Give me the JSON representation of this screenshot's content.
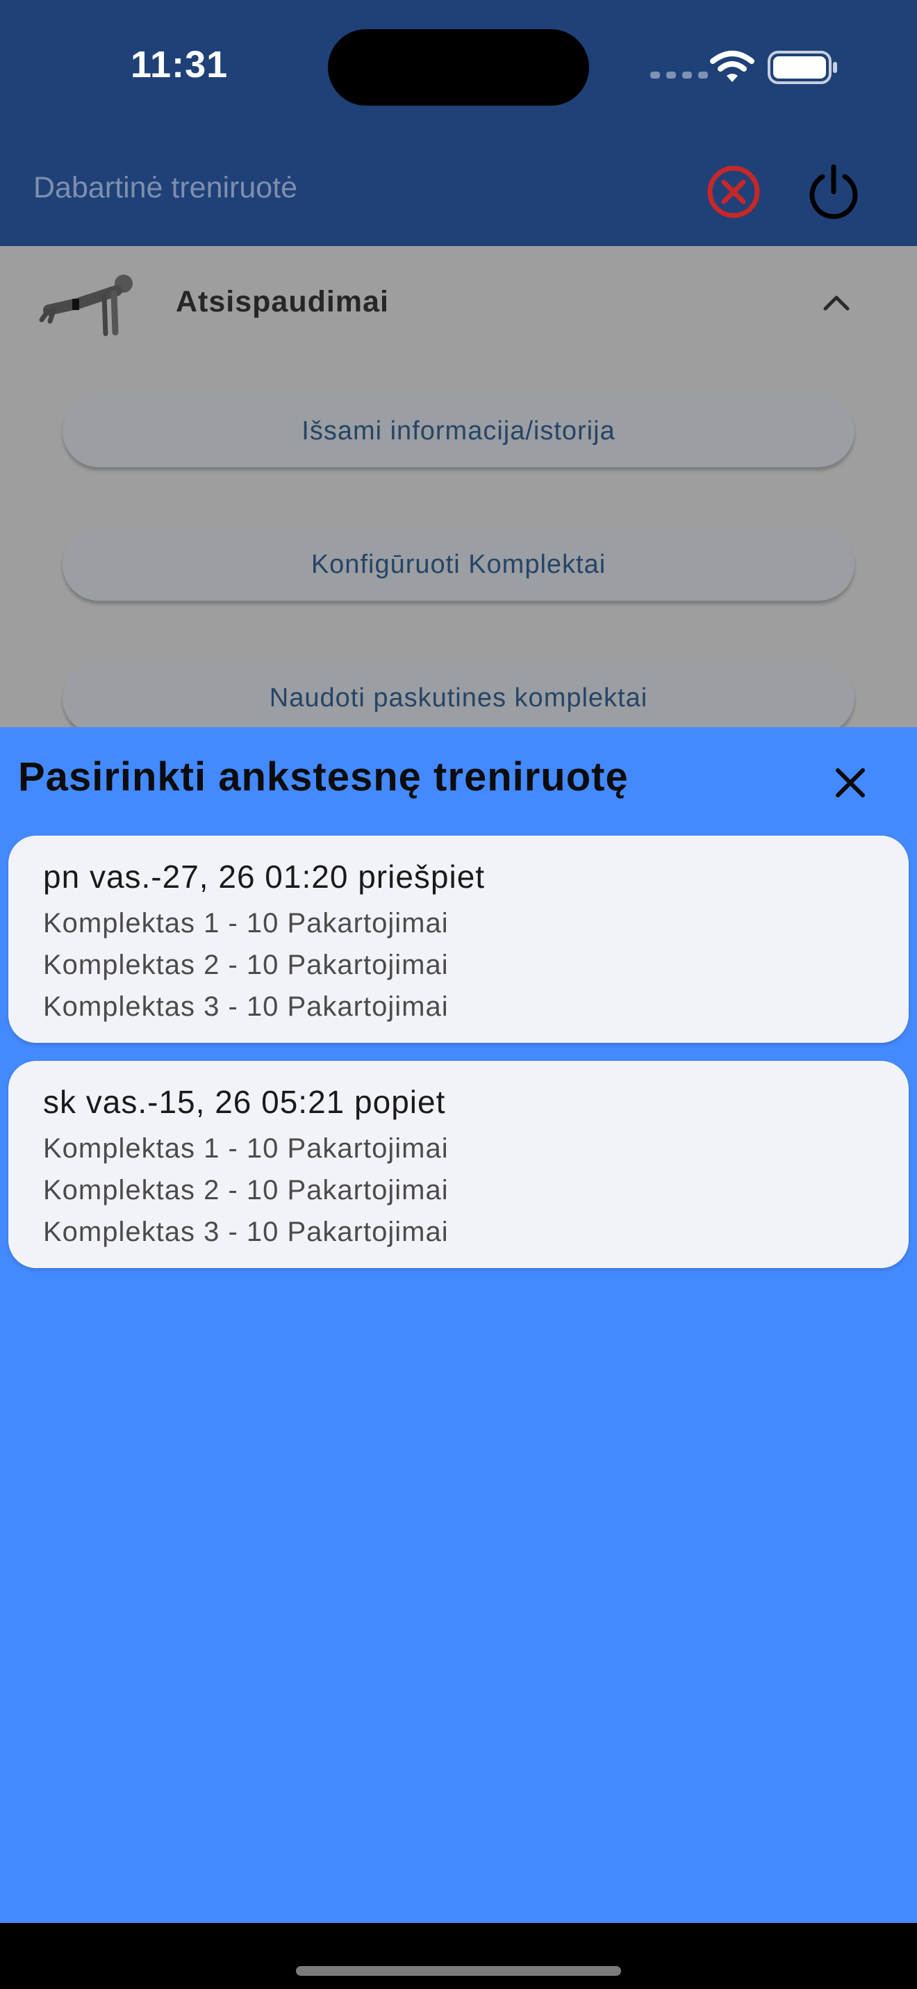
{
  "status_bar": {
    "time": "11:31"
  },
  "app_bar": {
    "title": "Dabartinė treniruotė",
    "icons": [
      "cancel-circle-icon",
      "power-icon"
    ],
    "colors": {
      "background": "#1f4178",
      "cancel": "#c62828"
    }
  },
  "exercise": {
    "name": "Atsispaudimai",
    "buttons": [
      {
        "label": "Išsami informacija/istorija"
      },
      {
        "label": "Konfigūruoti Komplektai"
      },
      {
        "label": "Naudoti paskutines komplektai"
      }
    ]
  },
  "sheet": {
    "title": "Pasirinkti ankstesnę treniruotę",
    "background": "#448aff",
    "workouts": [
      {
        "date": "pn vas.-27, 26 01:20 priešpiet",
        "sets": [
          "Komplektas 1 - 10 Pakartojimai",
          "Komplektas 2 - 10 Pakartojimai",
          "Komplektas 3 - 10 Pakartojimai"
        ]
      },
      {
        "date": "sk vas.-15, 26 05:21 popiet",
        "sets": [
          "Komplektas 1 - 10 Pakartojimai",
          "Komplektas 2 - 10 Pakartojimai",
          "Komplektas 3 - 10 Pakartojimai"
        ]
      }
    ]
  }
}
